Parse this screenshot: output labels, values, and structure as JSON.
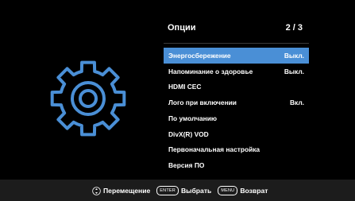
{
  "menu": {
    "title": "Опции",
    "page": "2 / 3",
    "items": [
      {
        "label": "Энергосбережение",
        "value": "Выкл."
      },
      {
        "label": "Напоминание о здоровье",
        "value": "Выкл."
      },
      {
        "label": "HDMI CEC",
        "value": ""
      },
      {
        "label": "Лого при включении",
        "value": "Вкл."
      },
      {
        "label": "По умолчанию",
        "value": ""
      },
      {
        "label": "DivX(R) VOD",
        "value": ""
      },
      {
        "label": "Первоначальная настройка",
        "value": ""
      },
      {
        "label": "Версия ПО",
        "value": ""
      }
    ]
  },
  "footer": {
    "move_label": "Перемещение",
    "enter_key": "ENTER",
    "select_label": "Выбрать",
    "menu_key": "MENU",
    "back_label": "Возврат"
  },
  "colors": {
    "background": "#000000",
    "highlight": "#4a8fd6",
    "gear": "#4a8fd6",
    "footer_bg": "#1c1c1c"
  },
  "icons": {
    "main": "gear-icon",
    "navigate": "navigate-arrows-icon"
  },
  "selected_index": 0
}
